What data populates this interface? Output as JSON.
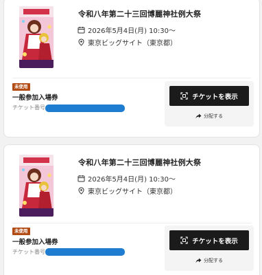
{
  "tickets": [
    {
      "event_title": "令和八年第二十三回博麗神社例大祭",
      "date": "2026年5月4日(月) 10:30〜",
      "venue": "東京ビッグサイト（東京都）",
      "status_badge": "未使用",
      "ticket_type": "一般参加入場券",
      "ticket_number_label": "チケット番号：",
      "show_button_label": "チケットを表示",
      "share_label": "分配する"
    },
    {
      "event_title": "令和八年第二十三回博麗神社例大祭",
      "date": "2026年5月4日(月) 10:30〜",
      "venue": "東京ビッグサイト（東京都）",
      "status_badge": "未使用",
      "ticket_type": "一般参加入場券",
      "ticket_number_label": "チケット番号：",
      "show_button_label": "チケットを表示",
      "share_label": "分配する"
    }
  ],
  "icons": {
    "date": "calendar-icon",
    "venue": "location-pin-icon",
    "show": "qr-scan-icon",
    "share": "share-arrow-icon"
  },
  "colors": {
    "badge": "#b24a14",
    "button": "#1b1b1b",
    "redaction": "#1f7dd1"
  }
}
